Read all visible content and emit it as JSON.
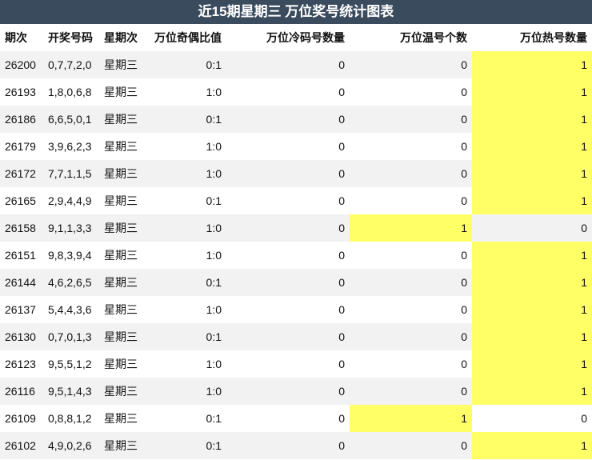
{
  "title": "近15期星期三 万位奖号统计图表",
  "headers": [
    "期次",
    "开奖号码",
    "星期次",
    "万位奇偶比值",
    "万位冷码号数量",
    "万位温号个数",
    "万位热号数量"
  ],
  "rows": [
    {
      "issue": "26200",
      "numbers": "0,7,7,2,0",
      "weekday": "星期三",
      "odd_even": "0:1",
      "cold": "0",
      "warm": "0",
      "hot": "1"
    },
    {
      "issue": "26193",
      "numbers": "1,8,0,6,8",
      "weekday": "星期三",
      "odd_even": "1:0",
      "cold": "0",
      "warm": "0",
      "hot": "1"
    },
    {
      "issue": "26186",
      "numbers": "6,6,5,0,1",
      "weekday": "星期三",
      "odd_even": "0:1",
      "cold": "0",
      "warm": "0",
      "hot": "1"
    },
    {
      "issue": "26179",
      "numbers": "3,9,6,2,3",
      "weekday": "星期三",
      "odd_even": "1:0",
      "cold": "0",
      "warm": "0",
      "hot": "1"
    },
    {
      "issue": "26172",
      "numbers": "7,7,1,1,5",
      "weekday": "星期三",
      "odd_even": "1:0",
      "cold": "0",
      "warm": "0",
      "hot": "1"
    },
    {
      "issue": "26165",
      "numbers": "2,9,4,4,9",
      "weekday": "星期三",
      "odd_even": "0:1",
      "cold": "0",
      "warm": "0",
      "hot": "1"
    },
    {
      "issue": "26158",
      "numbers": "9,1,1,3,3",
      "weekday": "星期三",
      "odd_even": "1:0",
      "cold": "0",
      "warm": "1",
      "hot": "0"
    },
    {
      "issue": "26151",
      "numbers": "9,8,3,9,4",
      "weekday": "星期三",
      "odd_even": "1:0",
      "cold": "0",
      "warm": "0",
      "hot": "1"
    },
    {
      "issue": "26144",
      "numbers": "4,6,2,6,5",
      "weekday": "星期三",
      "odd_even": "0:1",
      "cold": "0",
      "warm": "0",
      "hot": "1"
    },
    {
      "issue": "26137",
      "numbers": "5,4,4,3,6",
      "weekday": "星期三",
      "odd_even": "1:0",
      "cold": "0",
      "warm": "0",
      "hot": "1"
    },
    {
      "issue": "26130",
      "numbers": "0,7,0,1,3",
      "weekday": "星期三",
      "odd_even": "0:1",
      "cold": "0",
      "warm": "0",
      "hot": "1"
    },
    {
      "issue": "26123",
      "numbers": "9,5,5,1,2",
      "weekday": "星期三",
      "odd_even": "1:0",
      "cold": "0",
      "warm": "0",
      "hot": "1"
    },
    {
      "issue": "26116",
      "numbers": "9,5,1,4,3",
      "weekday": "星期三",
      "odd_even": "1:0",
      "cold": "0",
      "warm": "0",
      "hot": "1"
    },
    {
      "issue": "26109",
      "numbers": "0,8,8,1,2",
      "weekday": "星期三",
      "odd_even": "0:1",
      "cold": "0",
      "warm": "1",
      "hot": "0"
    },
    {
      "issue": "26102",
      "numbers": "4,9,0,2,6",
      "weekday": "星期三",
      "odd_even": "0:1",
      "cold": "0",
      "warm": "0",
      "hot": "1"
    }
  ],
  "colors": {
    "header_bg": "#3b4b5e",
    "highlight": "#ffff66",
    "stripe": "#f2f2f2"
  }
}
